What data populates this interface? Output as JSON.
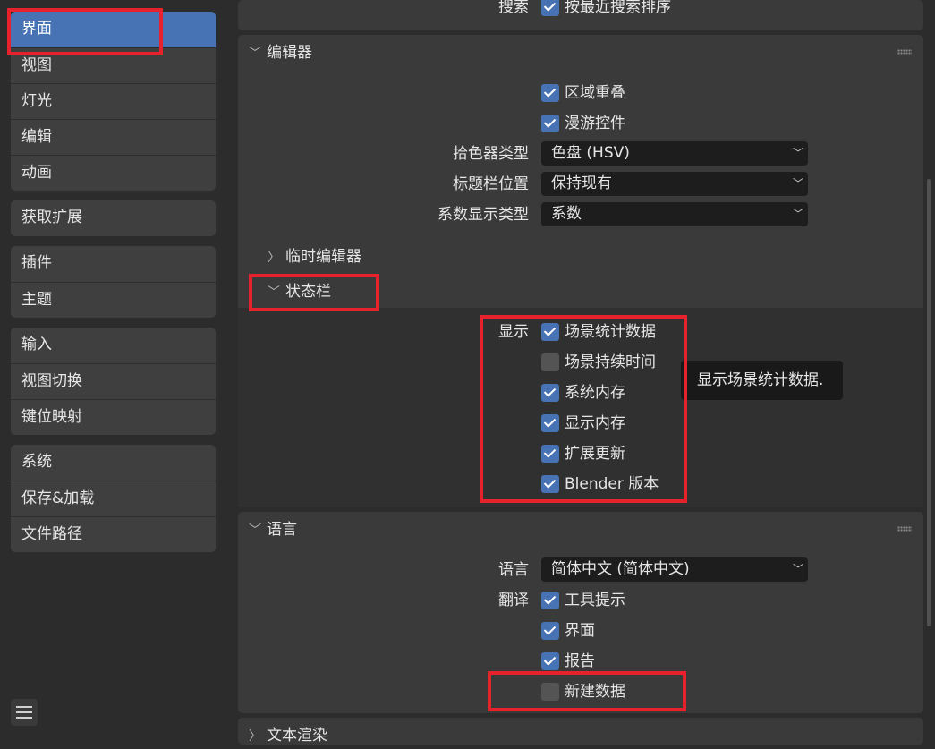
{
  "sidebar": {
    "groups": [
      [
        "界面",
        "视图",
        "灯光",
        "编辑",
        "动画"
      ],
      [
        "获取扩展"
      ],
      [
        "插件",
        "主题"
      ],
      [
        "输入",
        "视图切换",
        "键位映射"
      ],
      [
        "系统",
        "保存&加载",
        "文件路径"
      ]
    ],
    "active": "界面"
  },
  "search_row": {
    "label": "搜索",
    "checkbox_label": "按最近搜索排序",
    "checked": true
  },
  "editor": {
    "title": "编辑器",
    "region_overlap": {
      "label": "区域重叠",
      "checked": true
    },
    "navigation_controls": {
      "label": "漫游控件",
      "checked": true
    },
    "color_picker_type": {
      "label": "拾色器类型",
      "value": "色盘 (HSV)"
    },
    "header_position": {
      "label": "标题栏位置",
      "value": "保持现有"
    },
    "factor_display_type": {
      "label": "系数显示类型",
      "value": "系数"
    },
    "temp_editors": {
      "title": "临时编辑器"
    },
    "status_bar": {
      "title": "状态栏",
      "show_label": "显示",
      "items": [
        {
          "label": "场景统计数据",
          "checked": true
        },
        {
          "label": "场景持续时间",
          "checked": false
        },
        {
          "label": "系统内存",
          "checked": true
        },
        {
          "label": "显示内存",
          "checked": true
        },
        {
          "label": "扩展更新",
          "checked": true
        },
        {
          "label": "Blender 版本",
          "checked": true
        }
      ]
    }
  },
  "tooltip": {
    "text": "显示场景统计数据."
  },
  "language": {
    "title": "语言",
    "language": {
      "label": "语言",
      "value": "简体中文 (简体中文)"
    },
    "translate_label": "翻译",
    "items": [
      {
        "label": "工具提示",
        "checked": true
      },
      {
        "label": "界面",
        "checked": true
      },
      {
        "label": "报告",
        "checked": true
      },
      {
        "label": "新建数据",
        "checked": false
      }
    ]
  },
  "text_rendering": {
    "title": "文本渲染"
  },
  "colors": {
    "accent": "#4772b3",
    "highlight": "#e8222d"
  }
}
